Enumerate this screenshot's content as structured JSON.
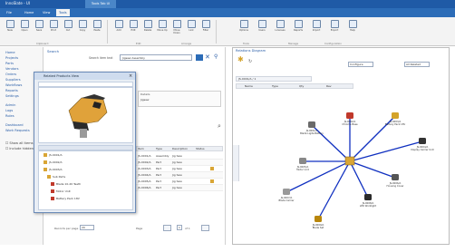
{
  "window": {
    "title": "InnoSlate - UI",
    "context_tab": "Tools Tab UI"
  },
  "menu": {
    "tabs": [
      "File",
      "Home",
      "View",
      "Tools"
    ],
    "active_index": 3
  },
  "ribbon": {
    "buttons_left": [
      "New",
      "Open",
      "Save",
      "Print",
      "Cut",
      "Copy",
      "Paste"
    ],
    "buttons_mid": [
      "Add",
      "Edit",
      "Delete",
      "Move Up",
      "Move Down",
      "Link",
      "Filter"
    ],
    "buttons_right": [
      "Options",
      "Users",
      "Licenses",
      "Reports",
      "Import",
      "Export",
      "Help"
    ],
    "group_labels": [
      "Clipboard",
      "Edit",
      "Arrange",
      "Tools",
      "Manage",
      "Configuration"
    ]
  },
  "left_nav": {
    "items": [
      "Home",
      "Projects",
      "Parts",
      "Vendors",
      "Orders",
      "Suppliers",
      "Workflows",
      "Reports",
      "Settings"
    ],
    "section_2": [
      "Admin",
      "Logs",
      "Roles"
    ],
    "section_3": [
      "Dashboard",
      "Work Requests"
    ],
    "checkboxes": [
      "Show all items",
      "Include hidden"
    ]
  },
  "main_panel": {
    "header": "Search",
    "search_label": "Search item text",
    "search_value": "Jigsaw Assembly",
    "detail_header": "Details",
    "detail_value": "Jigsaw",
    "grid_columns": [
      "Item",
      "Type",
      "Description",
      "Status"
    ],
    "grid_rows": [
      [
        "JS-0001/A",
        "Assembly",
        "Jig Saw",
        ""
      ],
      [
        "JS-0002/A",
        "Part",
        "Jig Saw",
        ""
      ],
      [
        "JS-0003/A",
        "Part",
        "Jig Saw",
        ""
      ],
      [
        "JS-0004/A",
        "Part",
        "Jig Saw",
        ""
      ],
      [
        "JS-0005/A",
        "Part",
        "Jig Saw",
        ""
      ],
      [
        "JS-0006/A",
        "Part",
        "Jig Saw",
        ""
      ]
    ],
    "pager_label": "Records per page",
    "pager_value": "20",
    "page_label": "Page",
    "page_value": "1",
    "page_of": "of 1"
  },
  "floating_window": {
    "title": "Related Products View",
    "tree_items": [
      "JS-0001/A",
      "JS-0002/A",
      "JS-0003/A",
      "Sub Parts",
      "Blade 10-20 Teeth",
      "Motor Unit",
      "Battery Pack 18V"
    ]
  },
  "right_panel": {
    "header": "Relations Diagram",
    "dropdown1": "Configure",
    "dropdown2": "All Related",
    "breadcrumb": "JS-0001/A / 1",
    "columns": [
      "Name",
      "Type",
      "Qty",
      "Rev"
    ],
    "nodes": [
      "JS-0001/A\nBlade Ligita Battery",
      "JS-0002/A\nChrome Base",
      "JS-0003/A\nBattery Pack 18V",
      "JS-0004/A\nDisplay Carrier Unit",
      "JS-0005/A\nMotor Unit",
      "JS-0006/A\nHousing Cover",
      "JS-0007/A\nBlade Carrier",
      "JS-0008/A\nLED Worklight",
      "JS-0009/A\nBlade Set"
    ]
  },
  "colors": {
    "title_bar": "#1f5aa6",
    "menu_bar": "#2c6cb7",
    "link": "#2a5ea8",
    "diagram_edge": "#1030c0",
    "item_icon": "#d9a636"
  }
}
